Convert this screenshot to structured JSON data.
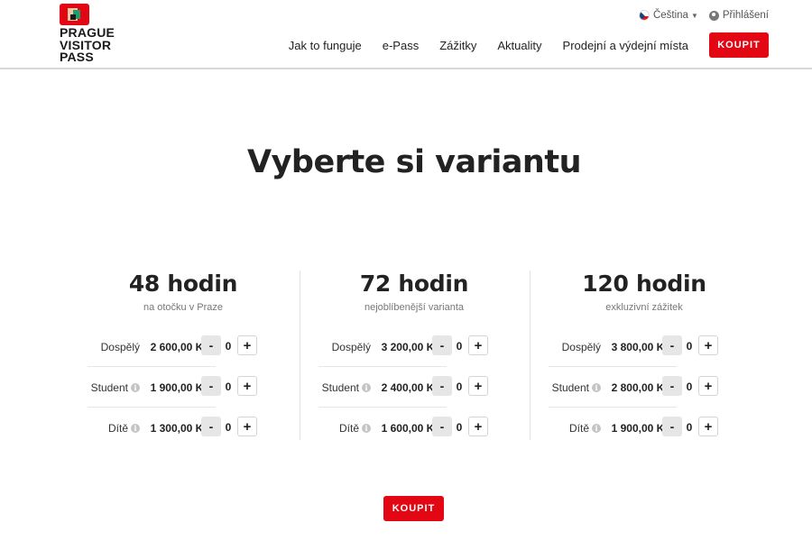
{
  "logo": {
    "lines": [
      "PRAGUE",
      "VISITOR",
      "PASS"
    ]
  },
  "topbar": {
    "language": "Čeština",
    "login": "Přihlášení"
  },
  "nav": {
    "items": [
      "Jak to funguje",
      "e-Pass",
      "Zážitky",
      "Aktuality",
      "Prodejní a výdejní místa"
    ],
    "buy_label": "KOUPIT"
  },
  "main": {
    "title": "Vyberte si variantu",
    "variants": [
      {
        "title": "48 hodin",
        "subtitle": "na otočku v Praze",
        "rows": [
          {
            "label": "Dospělý",
            "price": "2 600,00 Kč",
            "qty": "0",
            "info": false
          },
          {
            "label": "Student",
            "price": "1 900,00 Kč",
            "qty": "0",
            "info": true
          },
          {
            "label": "Dítě",
            "price": "1 300,00 Kč",
            "qty": "0",
            "info": true
          }
        ]
      },
      {
        "title": "72 hodin",
        "subtitle": "nejoblíbenější varianta",
        "rows": [
          {
            "label": "Dospělý",
            "price": "3 200,00 Kč",
            "qty": "0",
            "info": false
          },
          {
            "label": "Student",
            "price": "2 400,00 Kč",
            "qty": "0",
            "info": true
          },
          {
            "label": "Dítě",
            "price": "1 600,00 Kč",
            "qty": "0",
            "info": true
          }
        ]
      },
      {
        "title": "120 hodin",
        "subtitle": "exkluzivní zážitek",
        "rows": [
          {
            "label": "Dospělý",
            "price": "3 800,00 Kč",
            "qty": "0",
            "info": false
          },
          {
            "label": "Student",
            "price": "2 800,00 Kč",
            "qty": "0",
            "info": true
          },
          {
            "label": "Dítě",
            "price": "1 900,00 Kč",
            "qty": "0",
            "info": true
          }
        ]
      }
    ],
    "minus_symbol": "-",
    "plus_symbol": "+",
    "info_symbol": "i",
    "buy_label": "KOUPIT"
  },
  "colors": {
    "accent": "#e30613",
    "text": "#222222",
    "muted": "#777777"
  }
}
